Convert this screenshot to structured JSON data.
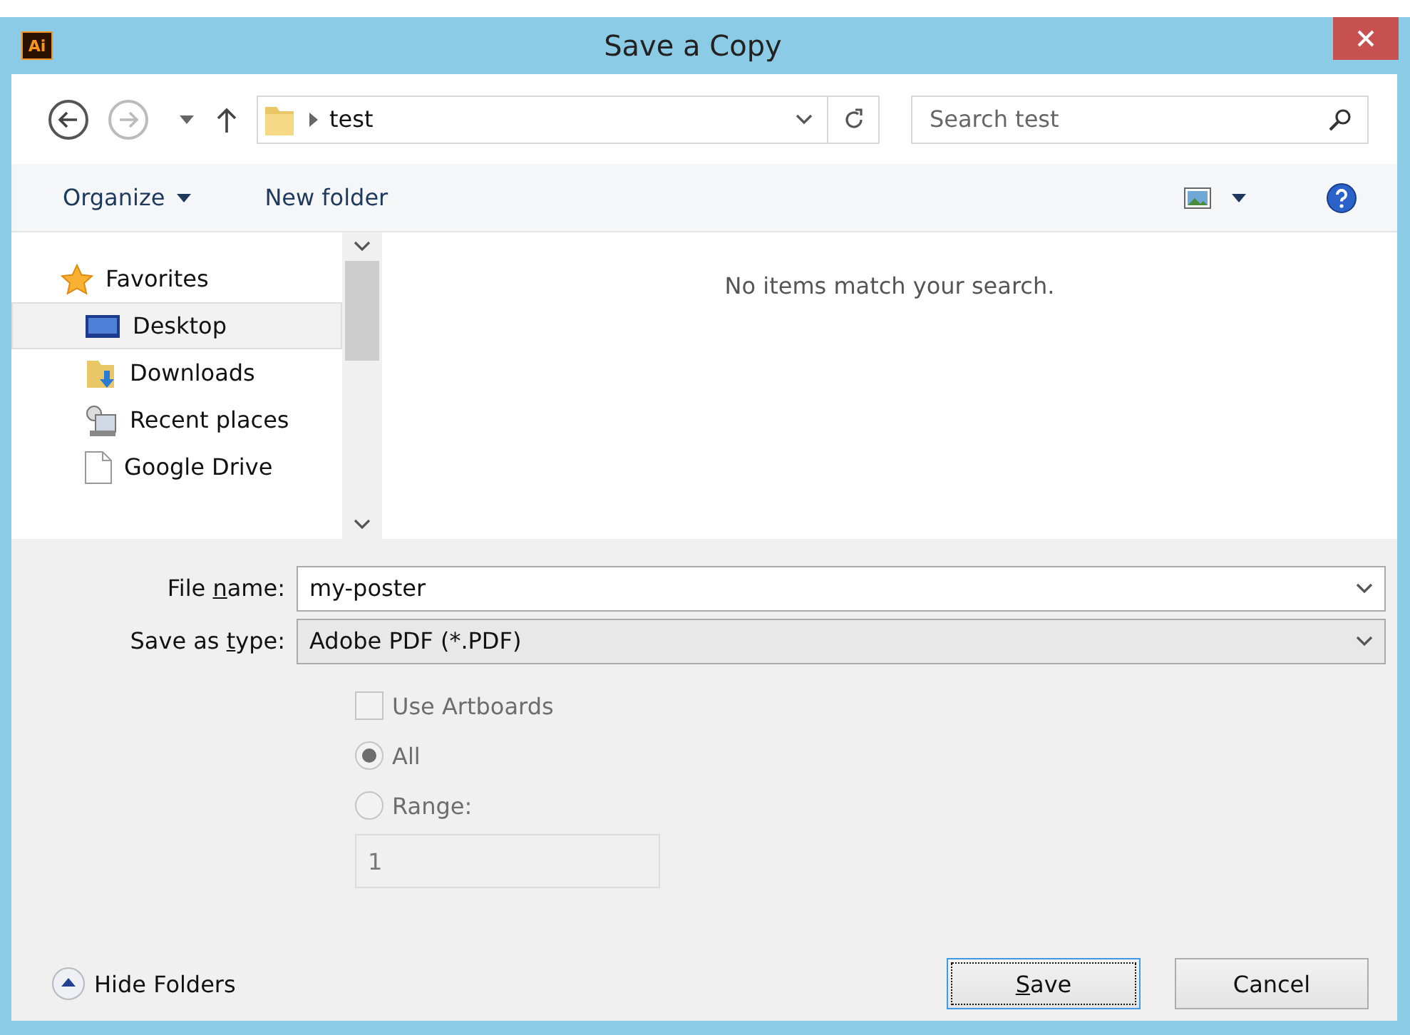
{
  "window": {
    "app_badge": "Ai",
    "title": "Save a Copy"
  },
  "navigation": {
    "back_enabled": true,
    "forward_enabled": false,
    "path": "test",
    "search": {
      "placeholder": "Search test"
    }
  },
  "toolbar": {
    "organize": "Organize",
    "new_folder": "New folder"
  },
  "sidebar": {
    "items": [
      {
        "label": "Favorites",
        "kind": "star",
        "selected": false
      },
      {
        "label": "Desktop",
        "kind": "desktop",
        "selected": true
      },
      {
        "label": "Downloads",
        "kind": "downloads",
        "selected": false
      },
      {
        "label": "Recent places",
        "kind": "recent",
        "selected": false
      },
      {
        "label": "Google Drive",
        "kind": "file",
        "selected": false
      }
    ]
  },
  "content": {
    "empty_message": "No items match your search."
  },
  "form": {
    "file_name": {
      "label": {
        "before": "File ",
        "key": "n",
        "after": "ame:"
      },
      "value": "my-poster"
    },
    "save_as_type": {
      "label": {
        "before": "Save as ",
        "key": "t",
        "after": "ype:"
      },
      "value": "Adobe PDF (*.PDF)"
    }
  },
  "options": {
    "use_artboards": {
      "label": "Use Artboards",
      "checked": false,
      "disabled": true
    },
    "radios": [
      {
        "label": "All",
        "selected": true,
        "disabled": true
      },
      {
        "label": "Range:",
        "selected": false,
        "disabled": true
      }
    ],
    "range_value": "1"
  },
  "footer": {
    "hide_folders": "Hide Folders",
    "buttons": [
      {
        "label": {
          "key": "S",
          "after": "ave"
        },
        "default": true
      },
      {
        "label": {
          "before": "Cancel"
        },
        "default": false
      }
    ]
  }
}
